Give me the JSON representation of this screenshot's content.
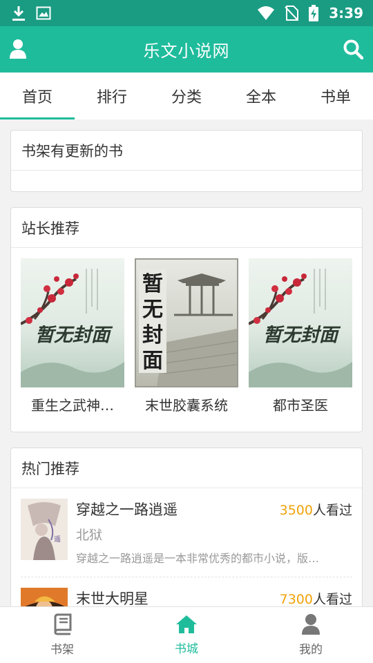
{
  "status_bar": {
    "time": "3:39"
  },
  "app_bar": {
    "title": "乐文小说网"
  },
  "tabs": [
    {
      "label": "首页",
      "active": true
    },
    {
      "label": "排行"
    },
    {
      "label": "分类"
    },
    {
      "label": "全本"
    },
    {
      "label": "书单"
    }
  ],
  "shelf_updates": {
    "title": "书架有更新的书"
  },
  "editor_picks": {
    "title": "站长推荐",
    "books": [
      {
        "title": "重生之武神…",
        "cover_text": "暂无封面"
      },
      {
        "title": "末世胶囊系统",
        "cover_text": "暂无封面"
      },
      {
        "title": "都市圣医",
        "cover_text": "暂无封面"
      }
    ]
  },
  "hot": {
    "title": "热门推荐",
    "books": [
      {
        "title": "穿越之一路逍遥",
        "count": "3500",
        "views_suffix": "人看过",
        "author": "北狱",
        "desc": "穿越之一路逍遥是一本非常优秀的都市小说，版…"
      },
      {
        "title": "末世大明星",
        "count": "7300",
        "views_suffix": "人看过"
      }
    ]
  },
  "bottom_nav": [
    {
      "label": "书架",
      "icon": "book-icon"
    },
    {
      "label": "书城",
      "icon": "home-icon",
      "active": true
    },
    {
      "label": "我的",
      "icon": "person-icon"
    }
  ],
  "colors": {
    "primary": "#1fbc9c",
    "status_bar": "#1a9c83",
    "accent_count": "#f0a30a"
  }
}
